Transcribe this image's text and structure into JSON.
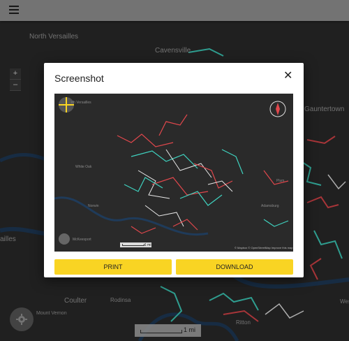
{
  "map": {
    "labels": {
      "north_versailles": "North Versailles",
      "cavensville": "Cavensville",
      "gauntertown": "Gauntertown",
      "ailles": "ailles",
      "coulter": "Coulter",
      "mount_vernon": "Mount Vernon",
      "rodinsa": "Rodinsa",
      "ritton": "Ritton",
      "west": "West"
    },
    "zoom_in": "+",
    "zoom_out": "–",
    "scale_label": "1 mi"
  },
  "modal": {
    "title": "Screenshot",
    "close": "✕",
    "print_label": "PRINT",
    "download_label": "DOWNLOAD"
  },
  "preview": {
    "labels": {
      "versailles": "rth Versailles",
      "plum": "Plum",
      "adamsburg": "Adamsburg",
      "white_oak": "White Oak",
      "norwin": "Norwin",
      "mckeesport": "McKeesport"
    },
    "scale_label": "1 mi",
    "attribution": "© Mapbox © OpenStreetMap  Improve this map"
  },
  "colors": {
    "accent": "#f9d423",
    "road_red": "#e0474c",
    "road_teal": "#3fd3c0",
    "road_white": "#e8e8e8",
    "river": "#1f3b5a"
  }
}
